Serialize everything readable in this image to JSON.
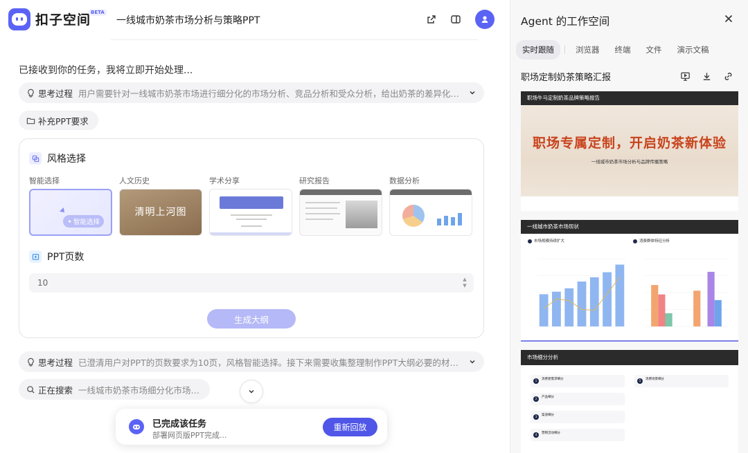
{
  "app": {
    "brand": "扣子空间",
    "beta": "BETA",
    "doc_title": "一线城市奶茶市场分析与策略PPT"
  },
  "chat": {
    "received": "已接收到你的任务，我将立即开始处理...",
    "thinking1": {
      "label": "思考过程",
      "desc": "用户需要针对一线城市奶茶市场进行细分化的市场分析、竞品分析和受众分析，给出奶茶的差异化品..."
    },
    "supplement_button": "补充PPT要求",
    "style_card": {
      "style_title": "风格选择",
      "styles": [
        {
          "name": "智能选择"
        },
        {
          "name": "人文历史"
        },
        {
          "name": "学术分享"
        },
        {
          "name": "研究报告"
        },
        {
          "name": "数据分析"
        }
      ],
      "smart_select_label": "智能选择",
      "history_thumb_big": "清明上河图",
      "pages_title": "PPT页数",
      "pages_value": "10",
      "generate_button": "生成大纲"
    },
    "thinking2": {
      "label": "思考过程",
      "desc": "已澄清用户对PPT的页数要求为10页，风格智能选择。接下来需要收集整理制作PPT大纲必要的材料信..."
    },
    "searching": {
      "label": "正在搜索",
      "desc": "一线城市奶茶市场细分化市场分析"
    }
  },
  "done": {
    "title": "已完成该任务",
    "subtitle": "部署网页版PPT完成...",
    "replay_button": "重新回放"
  },
  "panel": {
    "title": "Agent 的工作空间",
    "tabs": [
      "实时跟随",
      "浏览器",
      "终端",
      "文件",
      "演示文稿"
    ],
    "doc_name": "职场定制奶茶策略汇报",
    "slide1": {
      "header": "职场牛马定制奶茶品牌策略报告",
      "title": "职场专属定制，开启奶茶新体验",
      "subtitle": "一线城市奶茶市场分析与品牌传播策略"
    },
    "slide2": {
      "header": "一线城市奶茶市场现状",
      "sub_left": "市场规模持续扩大",
      "sub_right": "消费群体特征分析"
    },
    "slide3": {
      "header": "市场细分分析",
      "cards": [
        {
          "n": "1",
          "t": "消费者需求细分"
        },
        {
          "n": "2",
          "t": "产品细分"
        },
        {
          "n": "3",
          "t": "渠道细分"
        },
        {
          "n": "4",
          "t": "营销活动细分"
        },
        {
          "n": "5",
          "t": "消费场景细分"
        }
      ]
    }
  },
  "chart_data": [
    {
      "type": "bar",
      "values": [
        190,
        205,
        225,
        265,
        290,
        320,
        365
      ],
      "ylim": [
        0,
        400
      ]
    },
    {
      "type": "bar",
      "series": [
        {
          "values": [
            110,
            95
          ]
        },
        {
          "values": [
            85,
            0
          ]
        },
        {
          "values": [
            35,
            145
          ]
        },
        {
          "values": [
            0,
            70
          ]
        }
      ],
      "ylim": [
        0,
        180
      ]
    }
  ],
  "colors": {
    "accent": "#5b63f5",
    "title_red": "#c8431d"
  }
}
